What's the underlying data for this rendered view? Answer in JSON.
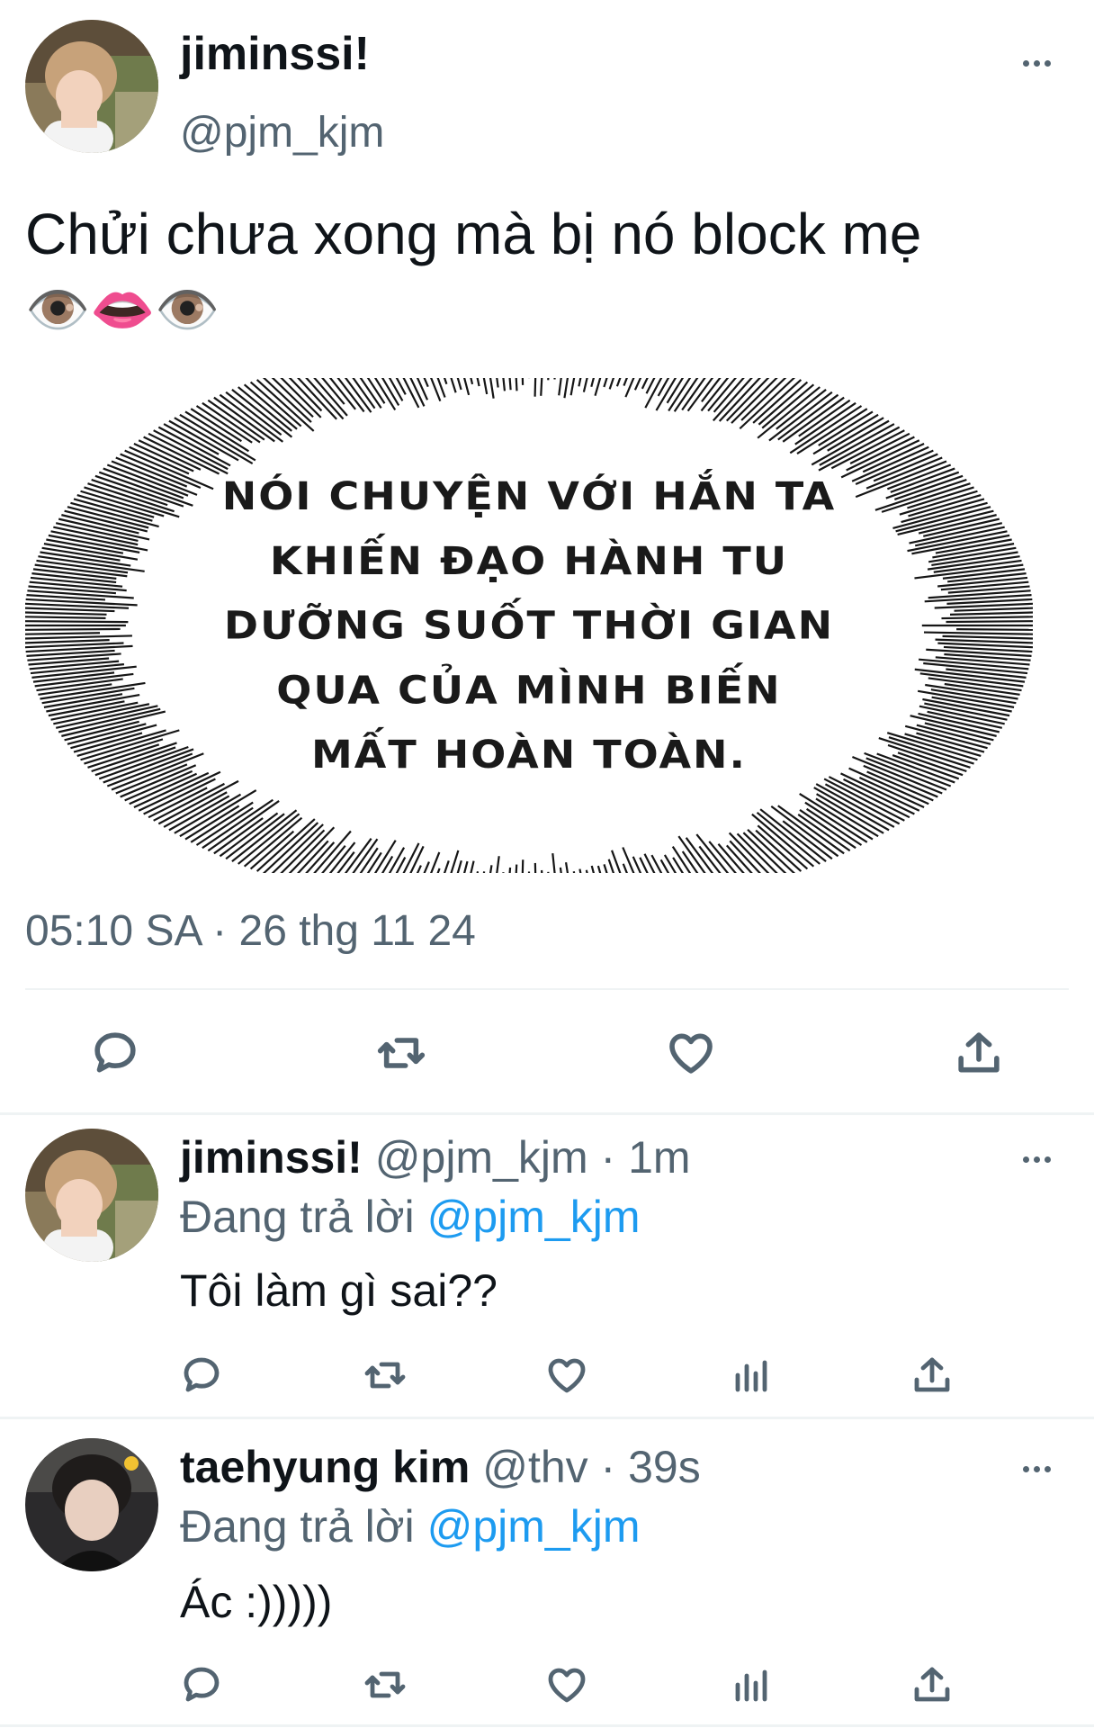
{
  "main_tweet": {
    "display_name": "jiminssi!",
    "handle": "@pjm_kjm",
    "text": "Chửi chưa xong mà bị nó block mẹ",
    "emoji": "👁️👄👁️",
    "image_text_lines": [
      "NÓI CHUYỆN VỚI HẮN TA",
      "KHIẾN ĐẠO HÀNH TU",
      "DƯỠNG SUỐT THỜI GIAN",
      "QUA CỦA MÌNH BIẾN",
      "MẤT HOÀN TOÀN."
    ],
    "timestamp": "05:10 SA · 26 thg 11 24",
    "actions": [
      "reply-icon",
      "retweet-icon",
      "like-icon",
      "share-icon"
    ]
  },
  "replies": [
    {
      "display_name": "jiminssi!",
      "meta": "@pjm_kjm · 1m",
      "replying_prefix": "Đang trả lời",
      "replying_to": "@pjm_kjm",
      "text": "Tôi làm gì sai??"
    },
    {
      "display_name": "taehyung kim",
      "meta": "@thv · 39s",
      "replying_prefix": "Đang trả lời",
      "replying_to": "@pjm_kjm",
      "text": "Ác :)))))"
    }
  ],
  "colors": {
    "link": "#1d9bf0",
    "muted": "#536471",
    "divider": "#eff3f4"
  }
}
